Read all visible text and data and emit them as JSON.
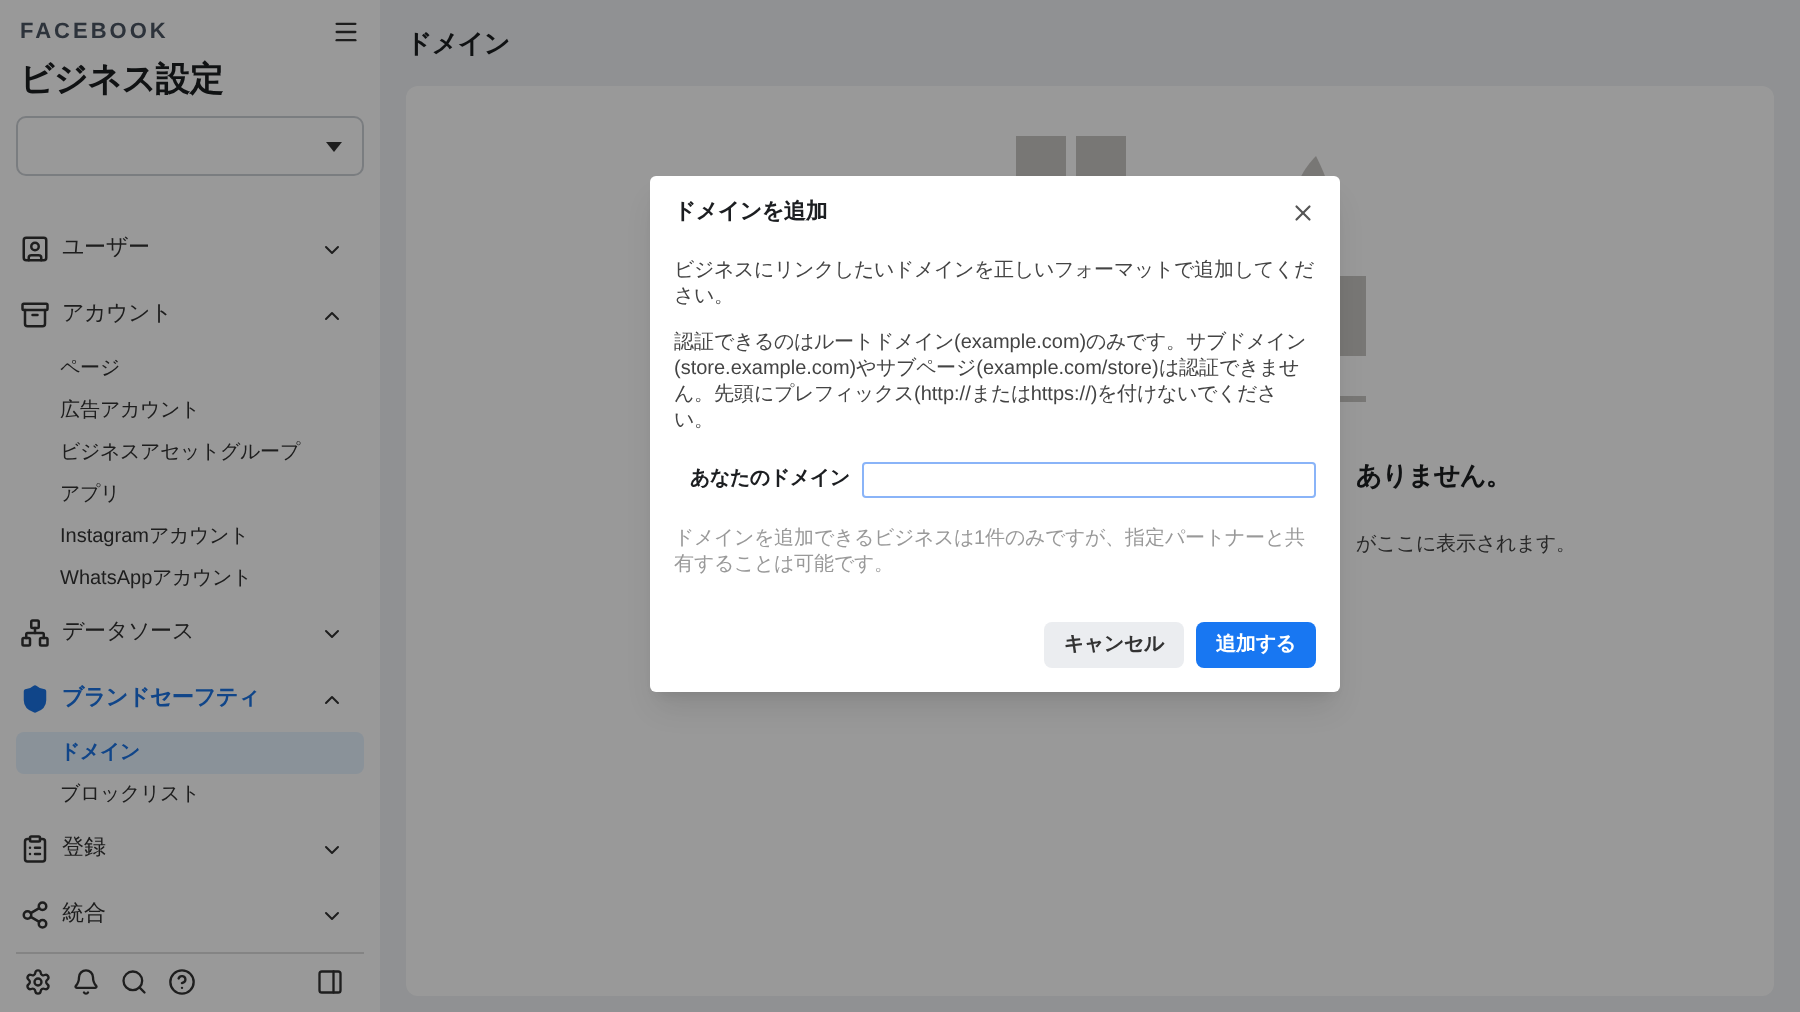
{
  "sidebar": {
    "brand": "FACEBOOK",
    "title": "ビジネス設定",
    "sections": [
      {
        "label": "ユーザー",
        "expanded": false,
        "selected": false
      },
      {
        "label": "アカウント",
        "expanded": true,
        "selected": false,
        "children": [
          {
            "label": "ページ",
            "selected": false
          },
          {
            "label": "広告アカウント",
            "selected": false
          },
          {
            "label": "ビジネスアセットグループ",
            "selected": false
          },
          {
            "label": "アプリ",
            "selected": false
          },
          {
            "label": "Instagramアカウント",
            "selected": false
          },
          {
            "label": "WhatsAppアカウント",
            "selected": false
          }
        ]
      },
      {
        "label": "データソース",
        "expanded": false,
        "selected": false
      },
      {
        "label": "ブランドセーフティ",
        "expanded": true,
        "selected": true,
        "children": [
          {
            "label": "ドメイン",
            "selected": true
          },
          {
            "label": "ブロックリスト",
            "selected": false
          }
        ]
      },
      {
        "label": "登録",
        "expanded": false,
        "selected": false
      },
      {
        "label": "統合",
        "expanded": false,
        "selected": false
      }
    ]
  },
  "page": {
    "title": "ドメイン",
    "empty_title": "ありません。",
    "empty_text": "がここに表示されます。"
  },
  "dialog": {
    "title": "ドメインを追加",
    "intro": "ビジネスにリンクしたいドメインを正しいフォーマットで追加してください。",
    "rules": "認証できるのはルートドメイン(example.com)のみです。サブドメイン(store.example.com)やサブページ(example.com/store)は認証できません。先頭にプレフィックス(http://またはhttps://)を付けないでください。",
    "field_label": "あなたのドメイン",
    "note": "ドメインを追加できるビジネスは1件のみですが、指定パートナーと共有することは可能です。",
    "buttons": [
      {
        "label": "キャンセル",
        "kind": "secondary"
      },
      {
        "label": "追加する",
        "kind": "primary"
      }
    ]
  }
}
